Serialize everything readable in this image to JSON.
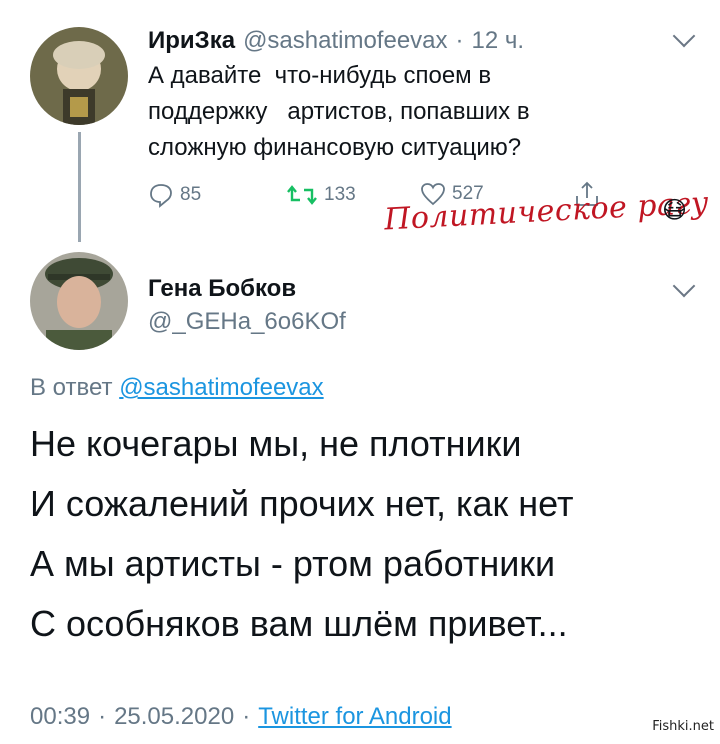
{
  "colors": {
    "link": "#1b95e0",
    "muted": "#657786",
    "retweet": "#17bf63",
    "watermark": "#c01623"
  },
  "tweet1": {
    "author_name": "ИриЗка",
    "handle": "@sashatimofeevax",
    "sep": "·",
    "time": "12 ч.",
    "text": "А давайте  что-нибудь споем в\nподдержку   артистов, попавших в\nсложную финансовую ситуацию?",
    "actions": {
      "replies": "85",
      "retweets": "133",
      "likes": "527"
    }
  },
  "watermark": {
    "text": "Политическое рагу",
    "emoji": "😷"
  },
  "tweet2": {
    "author_name": "Гена Бобков",
    "handle": "@_GEHa_6o6KOf",
    "reply_prefix": "В ответ",
    "reply_to": "@sashatimofeevax",
    "lines": [
      "Не кочегары мы, не плотники",
      "И сожалений прочих нет, как нет",
      "А мы артисты - ртом работники",
      "С особняков вам шлём привет..."
    ],
    "time": "00:39",
    "date": "25.05.2020",
    "sep": "·",
    "source": "Twitter for Android"
  },
  "site_mark": "Fishki.net"
}
